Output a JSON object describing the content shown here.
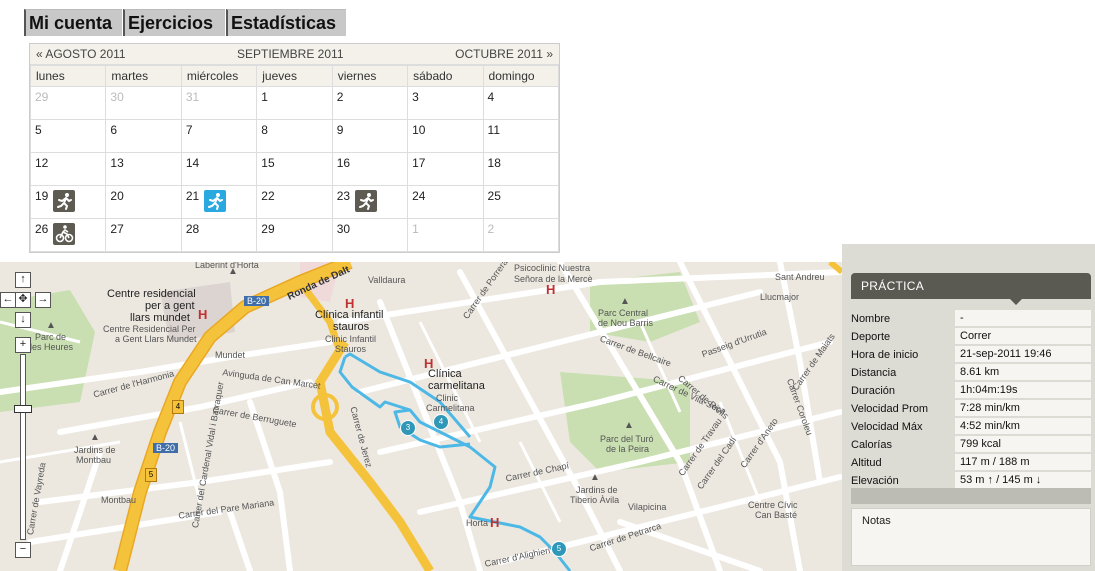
{
  "tabs": [
    "Mi cuenta",
    "Ejercicios",
    "Estadísticas"
  ],
  "calendar": {
    "prev": "« AGOSTO 2011",
    "current": "SEPTIEMBRE 2011",
    "next": "OCTUBRE 2011 »",
    "weekdays": [
      "lunes",
      "martes",
      "miércoles",
      "jueves",
      "viernes",
      "sábado",
      "domingo"
    ],
    "weeks": [
      [
        "29",
        "30",
        "31",
        "1",
        "2",
        "3",
        "4"
      ],
      [
        "5",
        "6",
        "7",
        "8",
        "9",
        "10",
        "11"
      ],
      [
        "12",
        "13",
        "14",
        "15",
        "16",
        "17",
        "18"
      ],
      [
        "19",
        "20",
        "21",
        "22",
        "23",
        "24",
        "25"
      ],
      [
        "26",
        "27",
        "28",
        "29",
        "30",
        "1",
        "2"
      ]
    ]
  },
  "activity_icons": {
    "d19": "running-icon",
    "d21": "running-icon",
    "d23": "running-icon",
    "d26": "cycling-icon"
  },
  "colors": {
    "activity_dark": "#5d5b52",
    "activity_blue": "#2aa8e0",
    "route": "#4db8e6",
    "major_road": "#f5c33b",
    "panel_header": "#5a5a52"
  },
  "map": {
    "labels": {
      "laberint": "Laberint d'Horta",
      "ronda": "Ronda de Dalt",
      "valldaura": "Valldaura",
      "psicoclinic1": "Psicoclinic Nuestra",
      "psicoclinic2": "Señora de la Mercè",
      "centre1": "Centre residencial",
      "centre2": "per a gent",
      "centre3": "llars mundet",
      "centre4": "Centre Residencial Per",
      "centre5": "a Gent Llars Mundet",
      "b20a": "B-20",
      "b20b": "B-20",
      "clinica_inf1": "Clínica infantil",
      "clinica_inf2": "stauros",
      "clinica_inf3": "Clinic Infantil",
      "clinica_inf4": "Stauros",
      "parc_heures1": "Parc de",
      "parc_heures2": "les Heures",
      "mundet": "Mundet",
      "avinguda": "Avinguda de Can Marcet",
      "clinica_carm1": "Clínica",
      "clinica_carm2": "carmelitana",
      "clinica_carm3": "Clinic",
      "clinica_carm4": "Carmelitana",
      "parc_central1": "Parc Central",
      "parc_central2": "de Nou Barris",
      "llucmajor": "Llucmajor",
      "belicaire": "Carrer de Bellcaire",
      "urrutia": "Passeig d'Urrutia",
      "harmonia": "Carrer de l'Harmonia",
      "berruguete": "Carrer de Berruguete",
      "jerez": "Carrer de Jerez",
      "chapi": "Carrer de Chapí",
      "parc_turo1": "Parc del Turó",
      "parc_turo2": "de la Peira",
      "montbau1": "Jardins de",
      "montbau2": "Montbau",
      "montbau": "Montbau",
      "jardins_tiberi1": "Jardins de",
      "jardins_tiberi2": "Tiberio Àvila",
      "vilapicina": "Vilapicina",
      "centre_civic1": "Centre Cívic",
      "centre_civic2": "Can Basté",
      "petrarca": "Carrer de Petrarca",
      "alighieri": "Carrer d'Alighieri",
      "horta": "Horta",
      "pare_mariana": "Carrer del Pare Mariana",
      "cardenal": "Carrer del Cardenal Vidal i Barraquer",
      "vayreda": "Carrer de Vayreda",
      "porrera": "Carrer de Porrera",
      "riells": "Carrer de Riells",
      "vilaseca": "Carrer de Vila-Seca",
      "travau": "Carrer de Travau",
      "cadi": "Carrer del Cadí",
      "aneto": "Carrer d'Aneto",
      "maiats": "Carrer de Maiats",
      "sant_andreu": "Sant Andreu",
      "coroleu": "Carrer Coroleu"
    },
    "markers": [
      "3",
      "4",
      "5"
    ],
    "road_badges": [
      "4",
      "5"
    ]
  },
  "panel": {
    "title": "PRÁCTICA",
    "rows": [
      {
        "label": "Nombre",
        "value": "-"
      },
      {
        "label": "Deporte",
        "value": "Correr"
      },
      {
        "label": "Hora de inicio",
        "value": "21-sep-2011 19:46"
      },
      {
        "label": "Distancia",
        "value": "8.61 km"
      },
      {
        "label": "Duración",
        "value": "1h:04m:19s"
      },
      {
        "label": "Velocidad Prom",
        "value": "7:28 min/km"
      },
      {
        "label": "Velocidad Máx",
        "value": "4:52 min/km"
      },
      {
        "label": "Calorías",
        "value": "799 kcal"
      },
      {
        "label": "Altitud",
        "value": "117 m / 188 m"
      },
      {
        "label": "Elevación",
        "value": "53 m ↑ / 145 m ↓"
      }
    ],
    "notes_label": "Notas"
  },
  "map_controls": {
    "up": "↑",
    "left": "←",
    "center": "✥",
    "right": "→",
    "down": "↓",
    "zoom_in": "+",
    "zoom_out": "−"
  }
}
